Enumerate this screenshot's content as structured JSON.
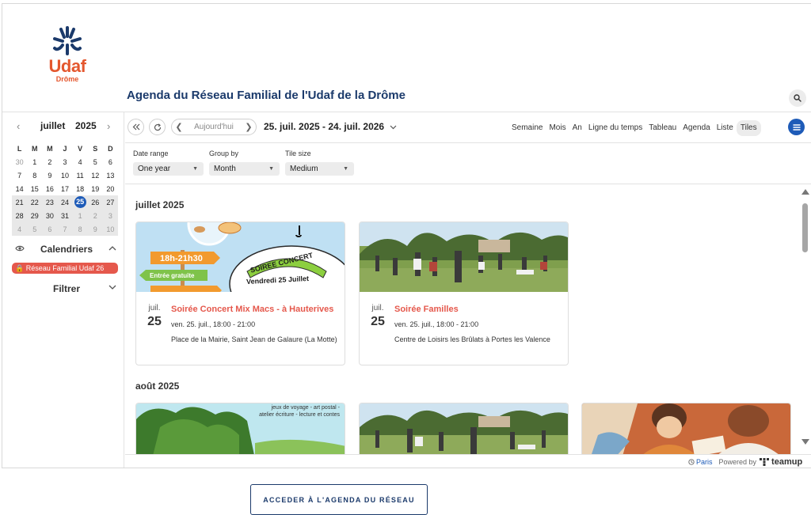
{
  "header": {
    "logo_text": "Udaf",
    "logo_subtext": "Drôme",
    "title": "Agenda du Réseau Familial de l'Udaf de la Drôme",
    "search_icon": "search-icon"
  },
  "mini_calendar": {
    "month": "juillet",
    "year": "2025",
    "prev": "‹",
    "next": "›",
    "weekdays": [
      "L",
      "M",
      "M",
      "J",
      "V",
      "S",
      "D"
    ],
    "weeks": [
      [
        "30",
        "1",
        "2",
        "3",
        "4",
        "5",
        "6"
      ],
      [
        "7",
        "8",
        "9",
        "10",
        "11",
        "12",
        "13"
      ],
      [
        "14",
        "15",
        "16",
        "17",
        "18",
        "19",
        "20"
      ],
      [
        "21",
        "22",
        "23",
        "24",
        "25",
        "26",
        "27"
      ],
      [
        "28",
        "29",
        "30",
        "31",
        "1",
        "2",
        "3"
      ],
      [
        "4",
        "5",
        "6",
        "7",
        "8",
        "9",
        "10"
      ]
    ],
    "today": "25"
  },
  "sidebar": {
    "calendars_label": "Calendriers",
    "calendar_item": "Réseau Familial Udaf 26",
    "filter_label": "Filtrer"
  },
  "toolbar": {
    "today_label": "Aujourd'hui",
    "range": "25. juil. 2025 - 24. juil. 2026",
    "views": [
      "Semaine",
      "Mois",
      "An",
      "Ligne du temps",
      "Tableau",
      "Agenda",
      "Liste",
      "Tiles"
    ],
    "active_view": "Tiles"
  },
  "filters": {
    "date_range": {
      "label": "Date range",
      "value": "One year"
    },
    "group_by": {
      "label": "Group by",
      "value": "Month"
    },
    "tile_size": {
      "label": "Tile size",
      "value": "Medium"
    }
  },
  "groups": [
    {
      "month": "juillet 2025",
      "events": [
        {
          "month_abbr": "juil.",
          "day": "25",
          "title": "Soirée Concert Mix Macs - à Hauterives",
          "when": "ven. 25. juil., 18:00 - 21:00",
          "where": "Place de la Mairie, Saint Jean de Galaure (La Motte)",
          "image_text": {
            "hours": "18h-21h30",
            "entry": "Entrée gratuite",
            "badge": "SOIREE CONCERT",
            "date": "Vendredi 25 Juillet"
          }
        },
        {
          "month_abbr": "juil.",
          "day": "25",
          "title": "Soirée Familles",
          "when": "ven. 25. juil., 18:00 - 21:00",
          "where": "Centre de Loisirs les Brûlats à Portes les Valence"
        }
      ]
    },
    {
      "month": "août 2025",
      "image_text": [
        "jeux de voyage - art postal -",
        "atelier écriture - lecture et contes"
      ]
    }
  ],
  "footer": {
    "timezone": "Paris",
    "powered_by": "Powered by",
    "brand": "teamup"
  },
  "cta_label": "ACCEDER À L'AGENDA DU RÉSEAU",
  "colors": {
    "navy": "#1b3a6b",
    "accent_red": "#e5584c",
    "today_blue": "#1e5bb8"
  }
}
